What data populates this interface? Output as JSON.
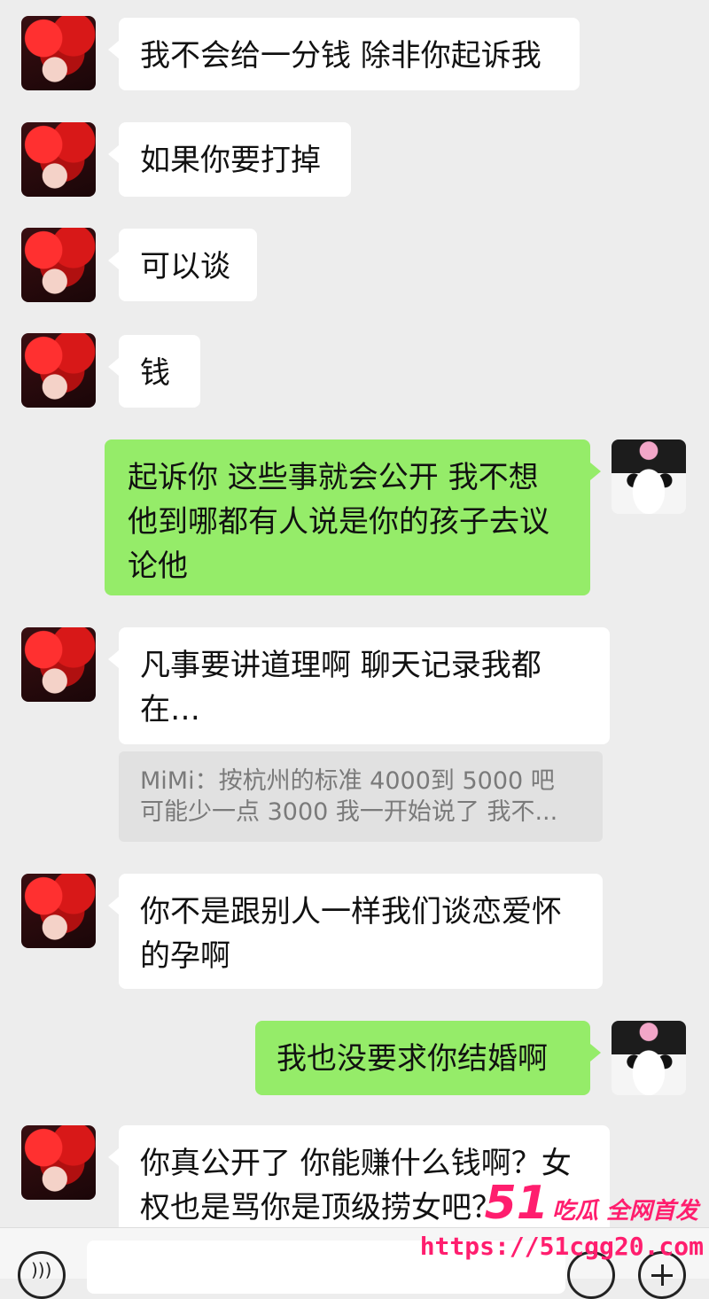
{
  "messages": [
    {
      "side": "other",
      "text": "我不会给一分钱 除非你起诉我"
    },
    {
      "side": "other",
      "text": "如果你要打掉"
    },
    {
      "side": "other",
      "text": "可以谈"
    },
    {
      "side": "other",
      "text": "钱"
    },
    {
      "side": "me",
      "text": "起诉你 这些事就会公开 我不想他到哪都有人说是你的孩子去议论他"
    },
    {
      "side": "other",
      "text": "凡事要讲道理啊 聊天记录我都在…"
    },
    {
      "side": "other",
      "text": "你不是跟别人一样我们谈恋爱怀的孕啊"
    },
    {
      "side": "me",
      "text": "我也没要求你结婚啊"
    },
    {
      "side": "other",
      "text": "你真公开了 你能赚什么钱啊？女权也是骂你是顶级捞女吧？"
    }
  ],
  "quote": {
    "line1": "MiMi：按杭州的标准 4000到 5000 吧",
    "line2": "可能少一点 3000 我一开始说了 我不..."
  },
  "watermark": {
    "brand_num": "51",
    "brand_tag": "吃瓜 全网首发",
    "url": "https://51cgg20.com"
  }
}
